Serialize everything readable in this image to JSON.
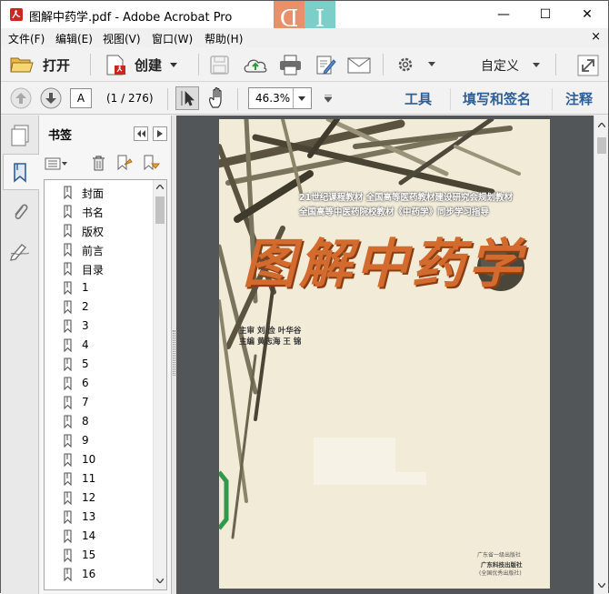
{
  "window": {
    "title": "图解中药学.pdf - Adobe Acrobat Pro",
    "minimize_glyph": "—",
    "maximize_glyph": "☐",
    "close_glyph": "✕",
    "overlay_letters": [
      "D",
      "I"
    ]
  },
  "menu": {
    "items": [
      "文件(F)",
      "编辑(E)",
      "视图(V)",
      "窗口(W)",
      "帮助(H)"
    ],
    "close_glyph": "×"
  },
  "toolbar": {
    "open_label": "打开",
    "create_label": "创建",
    "customize_label": "自定义"
  },
  "navbar": {
    "page_input_value": "A",
    "page_count": "(1 / 276)",
    "zoom_value": "46.3%",
    "tools_label": "工具",
    "fill_sign_label": "填写和签名",
    "comment_label": "注释"
  },
  "bookmarks": {
    "title": "书签",
    "items": [
      "封面",
      "书名",
      "版权",
      "前言",
      "目录",
      "1",
      "2",
      "3",
      "4",
      "5",
      "6",
      "7",
      "8",
      "9",
      "10",
      "11",
      "12",
      "13",
      "14",
      "15",
      "16"
    ]
  },
  "cover": {
    "series_line1": "21世纪课程教材 全国高等医药教材建设研究会规划教材",
    "series_line2": "全国高等中医药院校教材《中药学》同步学习指导",
    "title": "图解中药学",
    "chief_reviewer": "主审  刘  俭  叶华谷",
    "chief_editor": "主编  黄志海  王  锦",
    "publisher": "广东科技出版社",
    "publisher_sub": "(全国优秀出版社)",
    "publisher_seal": "广东省一级出版社"
  },
  "colors": {
    "link_blue": "#2c5f98",
    "title_orange": "#d46b2e",
    "doc_background": "#525659",
    "overlay_orange": "#e8906a",
    "overlay_teal": "#7ccfc8"
  }
}
